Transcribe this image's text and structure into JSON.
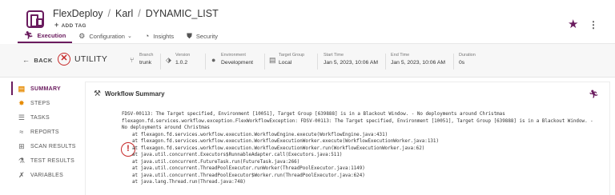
{
  "header": {
    "breadcrumb": [
      "FlexDeploy",
      "Karl",
      "DYNAMIC_LIST"
    ],
    "separator": "/",
    "add_tag_label": "ADD TAG",
    "star_icon": "star-icon",
    "menu_icon": "kebab-menu-icon"
  },
  "tabs": [
    {
      "label": "Execution",
      "icon": "run-icon",
      "active": true
    },
    {
      "label": "Configuration",
      "icon": "gear-icon",
      "has_dropdown": true
    },
    {
      "label": "Insights",
      "icon": "gauge-icon"
    },
    {
      "label": "Security",
      "icon": "shield-icon"
    }
  ],
  "infobar": {
    "back_label": "BACK",
    "status_label": "UTILITY",
    "status_icon": "error-circle-icon",
    "fields": [
      {
        "label": "Branch",
        "value": "trunk",
        "icon": "branch-icon"
      },
      {
        "label": "Version",
        "value": "1.0.2",
        "icon": "tag-icon"
      },
      {
        "label": "Environment",
        "value": "Development",
        "icon": "globe-icon"
      },
      {
        "label": "Target Group",
        "value": "Local",
        "icon": "target-group-icon"
      },
      {
        "label": "Start Time",
        "value": "Jan 5, 2023, 10:06 AM"
      },
      {
        "label": "End Time",
        "value": "Jan 5, 2023, 10:06 AM"
      },
      {
        "label": "Duration",
        "value": "0s"
      }
    ]
  },
  "sidebar": {
    "items": [
      {
        "label": "SUMMARY",
        "icon": "summary-icon",
        "active": true
      },
      {
        "label": "STEPS",
        "icon": "steps-icon"
      },
      {
        "label": "TASKS",
        "icon": "tasks-icon"
      },
      {
        "label": "REPORTS",
        "icon": "reports-icon"
      },
      {
        "label": "SCAN RESULTS",
        "icon": "scan-icon"
      },
      {
        "label": "TEST RESULTS",
        "icon": "test-icon"
      },
      {
        "label": "VARIABLES",
        "icon": "variables-icon"
      }
    ]
  },
  "main": {
    "title": "Workflow Summary",
    "log_lines": [
      "FDSV-00113: The Target specified, Environment [10051], Target Group [639888] is in a Blackout Window. - No deployments around Christmas",
      "flexagon.fd.services.workflow.exception.FlexWorkflowException: FDSV-00113: The Target specified, Environment [10051], Target Group [639888] is in a Blackout Window. -",
      "No deployments around Christmas",
      "at flexagon.fd.services.workflow.execution.WorkflowEngine.execute(WorkflowEngine.java:431)",
      "at flexagon.fd.services.workflow.execution.WorkflowExecutionWorker.execute(WorkflowExecutionWorker.java:131)",
      "at flexagon.fd.services.workflow.execution.WorkflowExecutionWorker.run(WorkflowExecutionWorker.java:62)",
      "at java.util.concurrent.Executors$RunnableAdapter.call(Executors.java:511)",
      "at java.util.concurrent.FutureTask.run(FutureTask.java:266)",
      "at java.util.concurrent.ThreadPoolExecutor.runWorker(ThreadPoolExecutor.java:1149)",
      "at java.util.concurrent.ThreadPoolExecutor$Worker.run(ThreadPoolExecutor.java:624)",
      "at java.lang.Thread.run(Thread.java:748)"
    ]
  },
  "colors": {
    "accent": "#6a1b5e",
    "error": "#c62828",
    "active_icon": "#e68a00"
  }
}
